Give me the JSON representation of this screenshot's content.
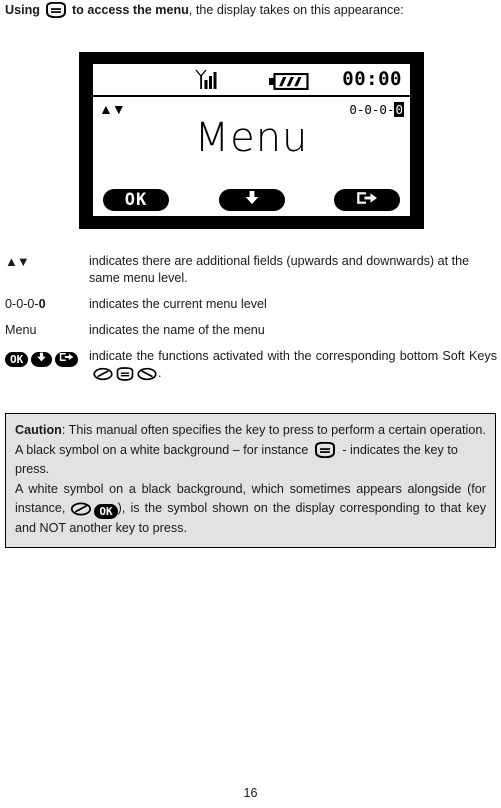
{
  "intro": {
    "prefix": "Using",
    "key_icon": "menu-key-icon",
    "bold_tail": "to access the menu",
    "rest": ", the display takes on this appearance:"
  },
  "device": {
    "status_bar": {
      "signal_icon": "signal-antenna-icon",
      "signal_bars": 3,
      "battery_icon": "battery-icon",
      "battery_segments": 3,
      "clock": "00:00"
    },
    "screen": {
      "scroll_arrows": "▲▼",
      "menu_level": {
        "segments": [
          "0",
          "0",
          "0"
        ],
        "separator": "-",
        "current": "0",
        "full": "0-0-0-0"
      },
      "title": "Menu",
      "soft_keys": [
        {
          "id": "softkey-ok",
          "label": "OK",
          "icon": ""
        },
        {
          "id": "softkey-down",
          "label": "",
          "icon": "arrow-down-icon"
        },
        {
          "id": "softkey-exit",
          "label": "",
          "icon": "exit-icon"
        }
      ]
    }
  },
  "legend": {
    "rows": [
      {
        "key_type": "arrows",
        "key_text": "▲▼",
        "desc": "indicates there are additional fields (upwards and downwards) at the same menu level."
      },
      {
        "key_type": "level",
        "key_prefix": "0-0-0-",
        "key_bold": "0",
        "desc": "indicates the current menu level"
      },
      {
        "key_type": "text",
        "key_text": "Menu",
        "desc": "indicates the name of the menu"
      },
      {
        "key_type": "badges",
        "badges": [
          "OK",
          "arrow-down-icon",
          "exit-icon"
        ],
        "desc_part1": "indicate the functions activated with the corresponding bottom Soft Keys",
        "desc_part2": "."
      }
    ]
  },
  "caution": {
    "heading": "Caution",
    "heading_sep": ": ",
    "para1": "This manual often specifies the key to press to perform a certain operation.",
    "para2_a": "A black symbol on a white background – for instance",
    "para2_b": "- indicates the key to press.",
    "para3_a": "A white symbol on a black background, which sometimes appears alongside (for instance,",
    "para3_b": "), is the symbol shown on the display corresponding to that key and NOT another key to press."
  },
  "footer": {
    "page_number": "16"
  },
  "colors": {
    "page_background": "#ffffff",
    "ink": "#000000",
    "caution_background": "#e2e2e2",
    "caution_border": "#000000",
    "screen_background": "#ffffff",
    "bezel": "#000000"
  }
}
